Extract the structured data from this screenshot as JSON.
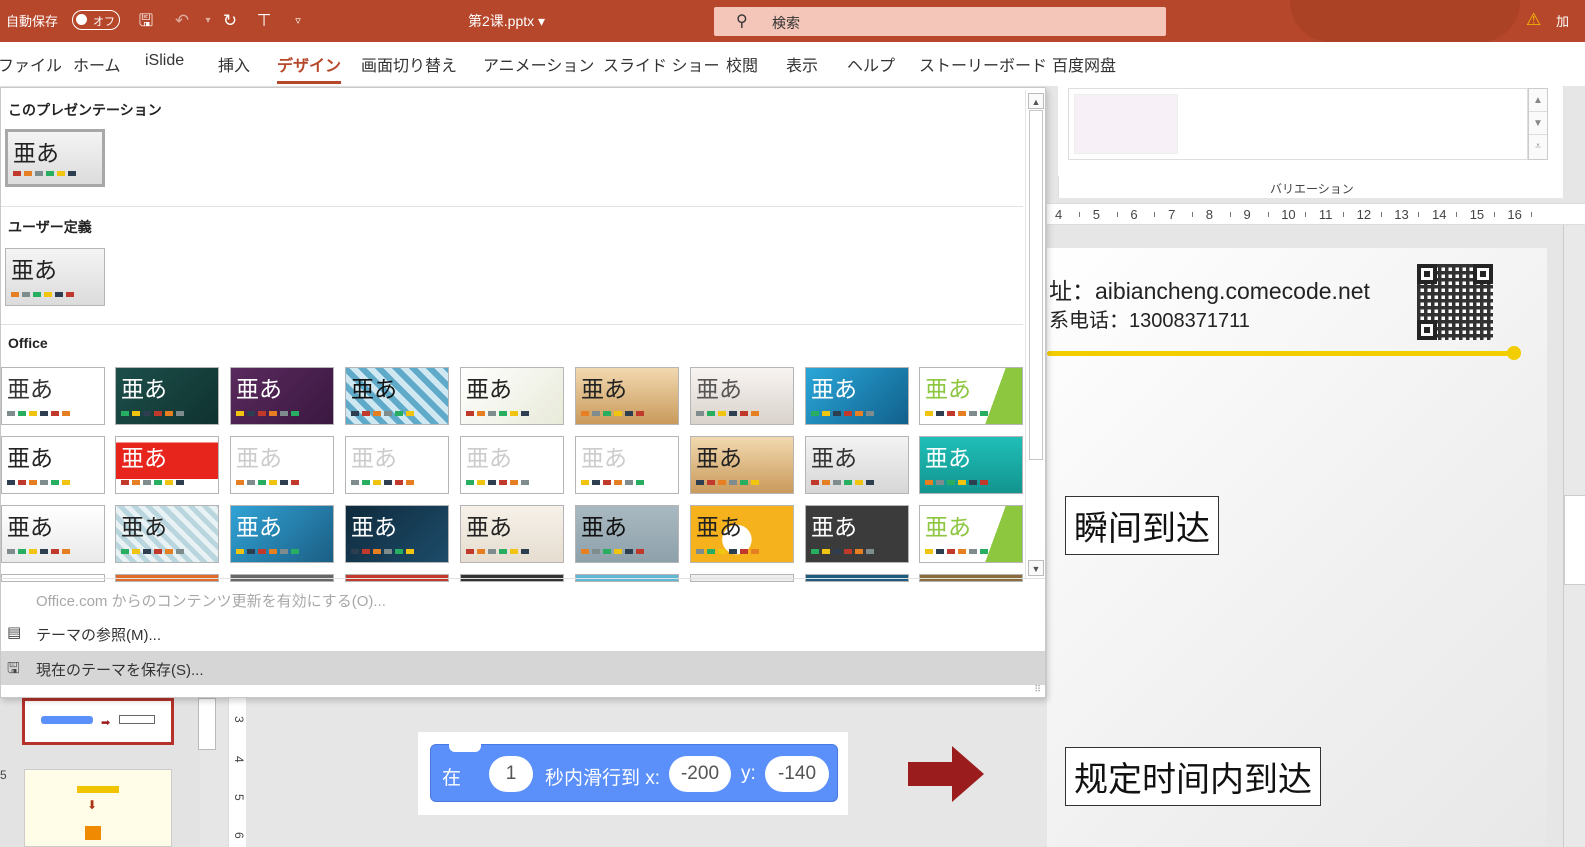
{
  "titlebar": {
    "autosave_label": "自動保存",
    "autosave_state": "オフ",
    "file_title": "第2课.pptx",
    "search_placeholder": "検索",
    "right_text": "加"
  },
  "ribbon_tabs": [
    "ファイル",
    "ホーム",
    "iSlide",
    "挿入",
    "デザイン",
    "画面切り替え",
    "アニメーション",
    "スライド ショー",
    "校閲",
    "表示",
    "ヘルプ",
    "ストーリーボード",
    "百度网盘"
  ],
  "active_tab": "デザイン",
  "variations": {
    "label": "バリエーション"
  },
  "ruler_numbers": [
    "4",
    "5",
    "6",
    "7",
    "8",
    "9",
    "10",
    "11",
    "12",
    "13",
    "14",
    "15",
    "16"
  ],
  "slide": {
    "url_line": "址：aibiancheng.comecode.net",
    "tel_line": "系电话：13008371711",
    "box1": "瞬间到达",
    "box2": "规定时间内到达"
  },
  "scratch_block": {
    "prefix": "在",
    "seconds": "1",
    "middle": "秒内滑行到 x:",
    "x_value": "-200",
    "y_label": "y:",
    "y_value": "-140"
  },
  "thumbnails": {
    "slide_number": "5"
  },
  "vertical_ruler": [
    "3",
    "4",
    "5",
    "6"
  ],
  "theme_dropdown": {
    "sections": [
      {
        "heading": "このプレゼンテーション"
      },
      {
        "heading": "ユーザー定義"
      },
      {
        "heading": "Office"
      }
    ],
    "theme_glyph": "亜あ",
    "menu": {
      "update": "Office.com からのコンテンツ更新を有効にする(O)...",
      "browse": "テーマの参照(M)...",
      "save": "現在のテーマを保存(S)..."
    }
  },
  "colors": {
    "accent": "#b7472a",
    "search_bg": "#f3c6b9",
    "scratch_blue": "#5b8ff9",
    "yellow_line": "#f2cd00",
    "arrow_red": "#9b1c1c"
  }
}
